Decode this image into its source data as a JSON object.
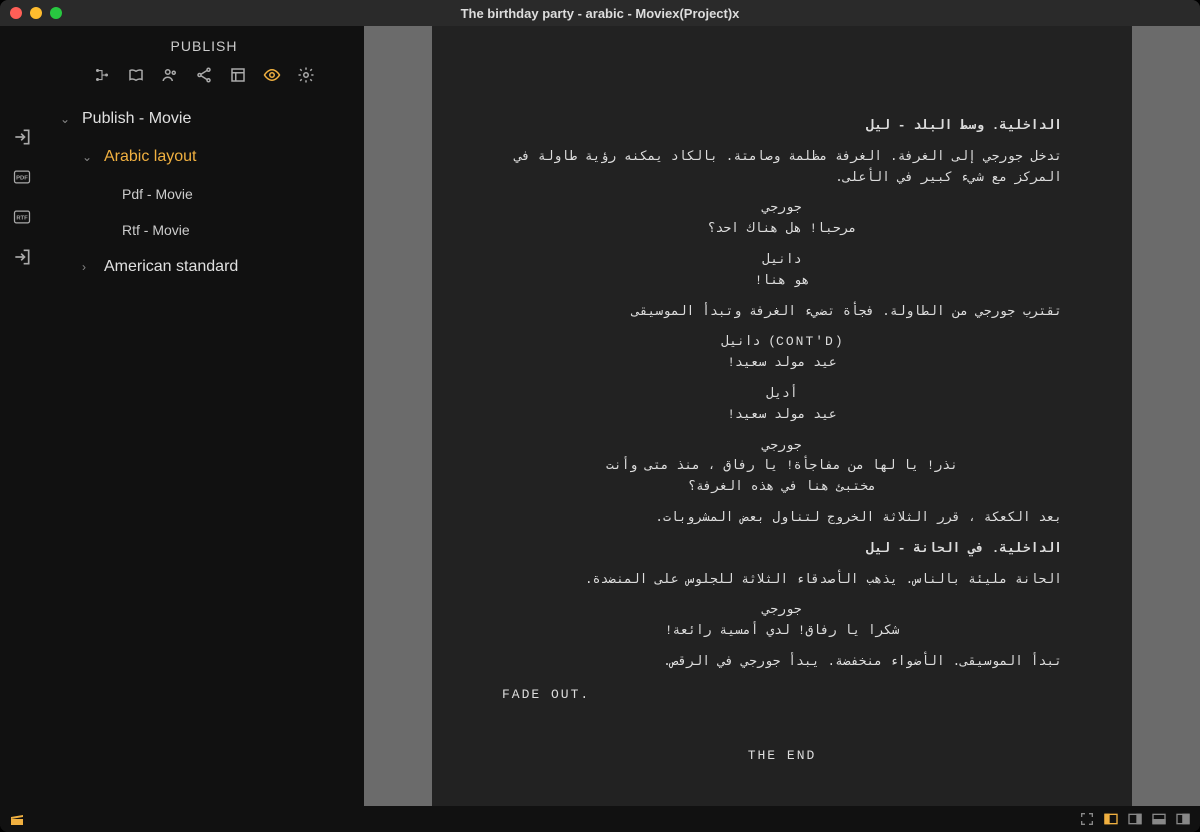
{
  "window": {
    "title": "The birthday party - arabic - Moviex(Project)x"
  },
  "sidebar": {
    "header": "PUBLISH",
    "tree": {
      "root": "Publish - Movie",
      "arabic": "Arabic layout",
      "pdf": "Pdf - Movie",
      "rtf": "Rtf - Movie",
      "american": "American standard"
    }
  },
  "script": {
    "scene1": "الداخلية. وسط البلد - ليل",
    "action1": "تدخل جورجي إلى الغرفة. الغرفة مظلمة وصامتة. بالكاد يمكنه رؤية طاولة في المركز مع شيء كبير في الأعلى.",
    "char1": "جورجي",
    "dlg1": "مرحبا! هل هناك احد؟",
    "char2": "دانيل",
    "dlg2": "ه‍و هنا!",
    "action2": "تقترب جورجي من الطاولة. فجأة تضيء الغرفة وتبدأ الموسيقى",
    "char3": "دانيل (CONT'D)",
    "dlg3": "عيد مولد سعيد!",
    "char4": "أديل",
    "dlg4": "عيد مولد سعيد!",
    "char5": "جورجي",
    "dlg5": "نذر! يا لها من مفاجأة! يا رفاق ، منذ متى وأنت مختبئ هنا في هذه الغرفة؟",
    "action3": "بعد الكعكة ، قرر الثلاثة الخروج لتناول بعض المشروبات.",
    "scene2": "الداخلية. في الحانة - ليل",
    "action4": "الحانة مليئة بالناس. يذهب الأصدقاء الثلاثة للجلوس على المنضدة.",
    "char6": "جورجي",
    "dlg6": "شكرا يا رفاق! لدي أمسية رائعة!",
    "action5": "تبدأ الموسيقى. الأضواء منخفضة. يبدأ جورجي في الرقص.",
    "transition": "FADE OUT.",
    "end": "THE END"
  }
}
